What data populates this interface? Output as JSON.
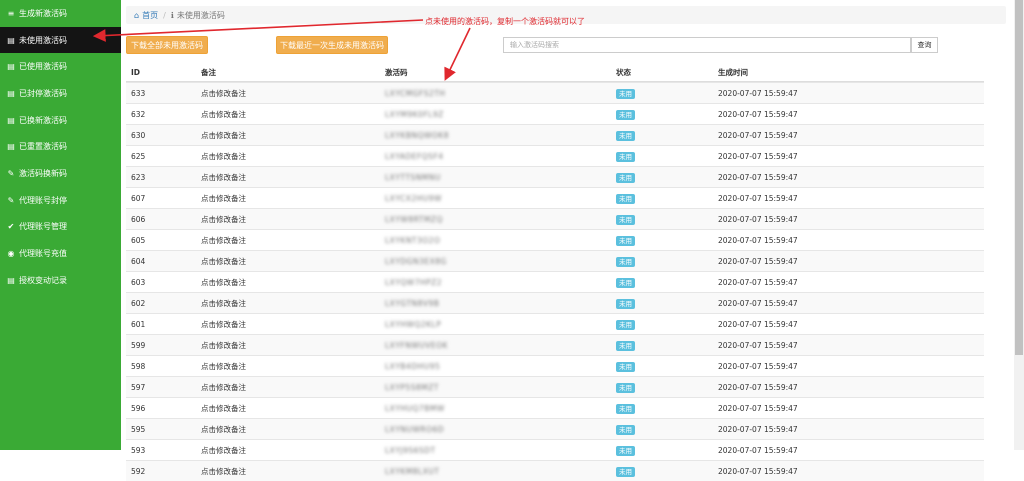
{
  "sidebar": {
    "items": [
      {
        "icon": "≡",
        "label": "生成新激活码",
        "active": false
      },
      {
        "icon": "▤",
        "label": "未使用激活码",
        "active": true
      },
      {
        "icon": "▤",
        "label": "已使用激活码",
        "active": false
      },
      {
        "icon": "▤",
        "label": "已封停激活码",
        "active": false
      },
      {
        "icon": "▤",
        "label": "已换新激活码",
        "active": false
      },
      {
        "icon": "▤",
        "label": "已重置激活码",
        "active": false
      },
      {
        "icon": "✎",
        "label": "激活码换新码",
        "active": false
      },
      {
        "icon": "✎",
        "label": "代理账号封停",
        "active": false
      },
      {
        "icon": "✔",
        "label": "代理账号管理",
        "active": false
      },
      {
        "icon": "◉",
        "label": "代理账号充值",
        "active": false
      },
      {
        "icon": "▤",
        "label": "授权变动记录",
        "active": false
      }
    ]
  },
  "breadcrumb": {
    "home": "首页",
    "current": "未使用激活码"
  },
  "annotation": "点未使用的激活码，复制一个激活码就可以了",
  "buttons": {
    "download_all": "下载全部未用激活码",
    "download_last": "下载最近一次生成未用激活码"
  },
  "search": {
    "placeholder": "输入激活码搜索",
    "button": "查询"
  },
  "table": {
    "headers": {
      "id": "ID",
      "note": "备注",
      "code": "激活码",
      "status": "状态",
      "time": "生成时间"
    },
    "rows": [
      {
        "id": "633",
        "note": "点击修改备注",
        "code": "LXYCMGFS2TH",
        "status": "未用",
        "time": "2020-07-07 15:59:47"
      },
      {
        "id": "632",
        "note": "点击修改备注",
        "code": "LXYM9K0FL9Z",
        "status": "未用",
        "time": "2020-07-07 15:59:47"
      },
      {
        "id": "630",
        "note": "点击修改备注",
        "code": "LXYKBNQWOK8",
        "status": "未用",
        "time": "2020-07-07 15:59:47"
      },
      {
        "id": "625",
        "note": "点击修改备注",
        "code": "LXYADEFQSF4",
        "status": "未用",
        "time": "2020-07-07 15:59:47"
      },
      {
        "id": "623",
        "note": "点击修改备注",
        "code": "LXYTTSNMNU",
        "status": "未用",
        "time": "2020-07-07 15:59:47"
      },
      {
        "id": "607",
        "note": "点击修改备注",
        "code": "LXYCX2HU9W",
        "status": "未用",
        "time": "2020-07-07 15:59:47"
      },
      {
        "id": "606",
        "note": "点击修改备注",
        "code": "LXYW8RTMZQ",
        "status": "未用",
        "time": "2020-07-07 15:59:47"
      },
      {
        "id": "605",
        "note": "点击修改备注",
        "code": "LXYKNT3O2O",
        "status": "未用",
        "time": "2020-07-07 15:59:47"
      },
      {
        "id": "604",
        "note": "点击修改备注",
        "code": "LXYDGN3EX8G",
        "status": "未用",
        "time": "2020-07-07 15:59:47"
      },
      {
        "id": "603",
        "note": "点击修改备注",
        "code": "LXYQW7HPZ2",
        "status": "未用",
        "time": "2020-07-07 15:59:47"
      },
      {
        "id": "602",
        "note": "点击修改备注",
        "code": "LXYGTN8V9B",
        "status": "未用",
        "time": "2020-07-07 15:59:47"
      },
      {
        "id": "601",
        "note": "点击修改备注",
        "code": "LXYHWQ2KLP",
        "status": "未用",
        "time": "2020-07-07 15:59:47"
      },
      {
        "id": "599",
        "note": "点击修改备注",
        "code": "LXYFNWUVEOK",
        "status": "未用",
        "time": "2020-07-07 15:59:47"
      },
      {
        "id": "598",
        "note": "点击修改备注",
        "code": "LXYB4DHU95",
        "status": "未用",
        "time": "2020-07-07 15:59:47"
      },
      {
        "id": "597",
        "note": "点击修改备注",
        "code": "LXYP5S8MZT",
        "status": "未用",
        "time": "2020-07-07 15:59:47"
      },
      {
        "id": "596",
        "note": "点击修改备注",
        "code": "LXYHUQ7BMW",
        "status": "未用",
        "time": "2020-07-07 15:59:47"
      },
      {
        "id": "595",
        "note": "点击修改备注",
        "code": "LXYNUWRO6D",
        "status": "未用",
        "time": "2020-07-07 15:59:47"
      },
      {
        "id": "593",
        "note": "点击修改备注",
        "code": "LXYJ9S6SDT",
        "status": "未用",
        "time": "2020-07-07 15:59:47"
      },
      {
        "id": "592",
        "note": "点击修改备注",
        "code": "LXYKM8LXUT",
        "status": "未用",
        "time": "2020-07-07 15:59:47"
      }
    ]
  },
  "colors": {
    "sidebar": "#3aaa35",
    "active": "#141414",
    "button": "#f0ad4e",
    "badge": "#5bc0de",
    "annotation": "#e0282e"
  }
}
